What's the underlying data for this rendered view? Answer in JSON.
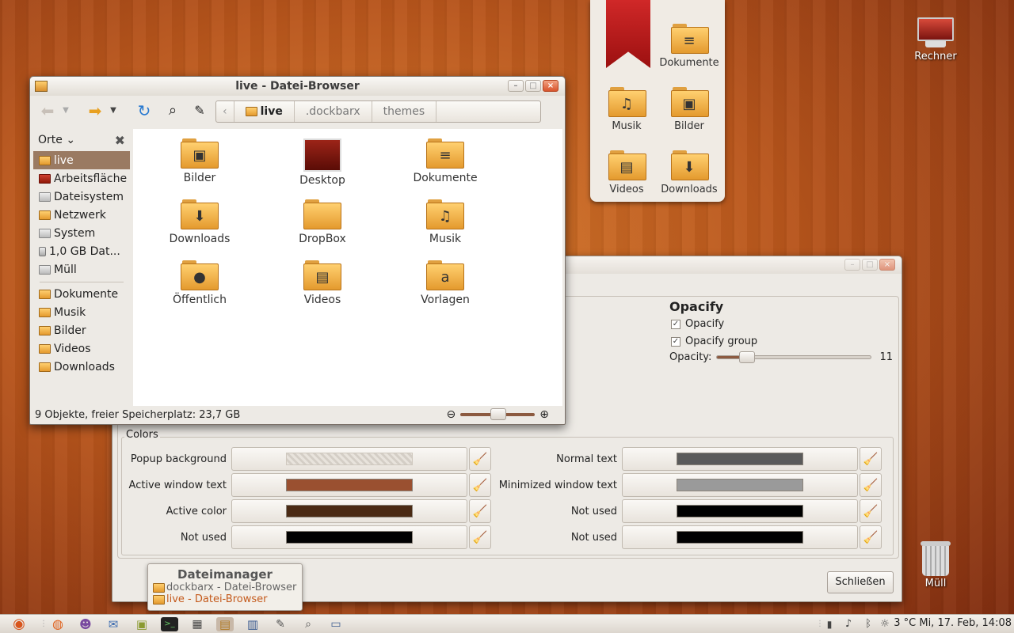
{
  "desktop": {
    "computer_label": "Rechner",
    "trash_label": "Müll"
  },
  "stack_popup": {
    "items": [
      {
        "label": "Dokumente",
        "icon": "documents-folder-icon"
      },
      {
        "label": "Musik",
        "icon": "music-folder-icon"
      },
      {
        "label": "Bilder",
        "icon": "pictures-folder-icon"
      },
      {
        "label": "Videos",
        "icon": "videos-folder-icon"
      },
      {
        "label": "Downloads",
        "icon": "downloads-folder-icon"
      }
    ]
  },
  "file_browser": {
    "title": "live - Datei-Browser",
    "breadcrumbs": [
      "live",
      ".dockbarx",
      "themes"
    ],
    "sidebar_header": "Orte",
    "places": [
      {
        "label": "live",
        "selected": true
      },
      {
        "label": "Arbeitsfläche"
      },
      {
        "label": "Dateisystem"
      },
      {
        "label": "Netzwerk"
      },
      {
        "label": "System"
      },
      {
        "label": "1,0 GB Dat..."
      },
      {
        "label": "Müll"
      }
    ],
    "bookmarks": [
      {
        "label": "Dokumente"
      },
      {
        "label": "Musik"
      },
      {
        "label": "Bilder"
      },
      {
        "label": "Videos"
      },
      {
        "label": "Downloads"
      }
    ],
    "files": [
      {
        "label": "Bilder",
        "glyph": "▣"
      },
      {
        "label": "Desktop",
        "glyph": ""
      },
      {
        "label": "Dokumente",
        "glyph": "≡"
      },
      {
        "label": "Downloads",
        "glyph": "⬇"
      },
      {
        "label": "DropBox",
        "glyph": ""
      },
      {
        "label": "Musik",
        "glyph": "♫"
      },
      {
        "label": "Öffentlich",
        "glyph": "●"
      },
      {
        "label": "Videos",
        "glyph": "▤"
      },
      {
        "label": "Vorlagen",
        "glyph": "a"
      }
    ],
    "status": "9 Objekte, freier Speicherplatz: 23,7 GB"
  },
  "prefs_dialog": {
    "opacify": {
      "title": "Opacify",
      "opacify_label": "Opacify",
      "opacify_checked": true,
      "group_label": "Opacify group",
      "group_checked": true,
      "opacity_label": "Opacity:",
      "opacity_value": "11",
      "opacity_fraction": 0.11
    },
    "colors": {
      "legend": "Colors",
      "left": [
        {
          "label": "Popup background",
          "color": "pattern"
        },
        {
          "label": "Active window text",
          "color": "#9a5030"
        },
        {
          "label": "Active color",
          "color": "#4a2a14"
        },
        {
          "label": "Not used",
          "color": "#000000"
        }
      ],
      "right": [
        {
          "label": "Normal text",
          "color": "#5a5a5a"
        },
        {
          "label": "Minimized window text",
          "color": "#9a9a9a"
        },
        {
          "label": "Not used",
          "color": "#000000"
        },
        {
          "label": "Not used",
          "color": "#000000"
        }
      ]
    },
    "close_label": "Schließen"
  },
  "tooltip": {
    "title": "Dateimanager",
    "items": [
      {
        "label": "dockbarx - Datei-Browser",
        "active": false
      },
      {
        "label": "live - Datei-Browser",
        "active": true
      }
    ]
  },
  "panel": {
    "clock": "3 °C Mi, 17. Feb, 14:08"
  },
  "colors": {
    "accent": "#c45a1c",
    "selection": "#9a7a62"
  }
}
